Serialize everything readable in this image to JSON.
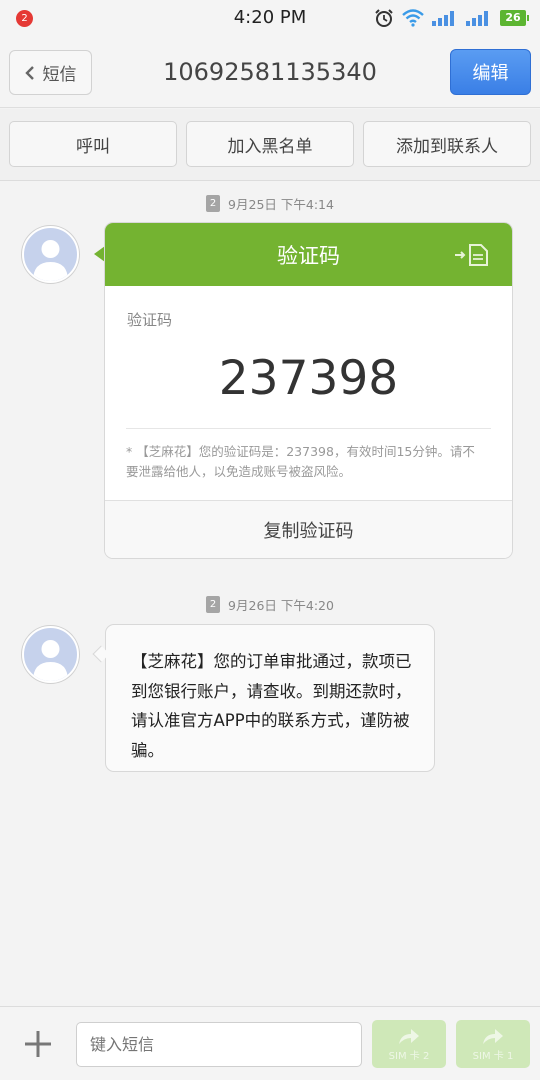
{
  "status_bar": {
    "notification_count": "2",
    "time": "4:20 PM",
    "battery": "26",
    "icons": [
      "alarm-icon",
      "wifi-icon",
      "signal-icon",
      "signal-icon"
    ]
  },
  "header": {
    "back_label": "短信",
    "title": "10692581135340",
    "edit_label": "编辑"
  },
  "actions": {
    "call": "呼叫",
    "blacklist": "加入黑名单",
    "add_contact": "添加到联系人"
  },
  "messages": [
    {
      "timestamp": "9月25日 下午4:14",
      "sim": "2",
      "card_title": "验证码",
      "card_label": "验证码",
      "code": "237398",
      "note": "* 【芝麻花】您的验证码是：237398，有效时间15分钟。请不要泄露给他人，以免造成账号被盗风险。",
      "copy_label": "复制验证码"
    },
    {
      "timestamp": "9月26日 下午4:20",
      "sim": "2",
      "text": "【芝麻花】您的订单审批通过，款项已到您银行账户，请查收。到期还款时，请认准官方APP中的联系方式，谨防被骗。"
    }
  ],
  "compose": {
    "placeholder": "键入短信",
    "send_sim2": "SIM 卡 2",
    "send_sim1": "SIM 卡 1"
  },
  "colors": {
    "card_green": "#74b331",
    "edit_blue": "#4a8cee",
    "battery_green": "#5cb531",
    "send_disabled": "#cfe8b8"
  }
}
